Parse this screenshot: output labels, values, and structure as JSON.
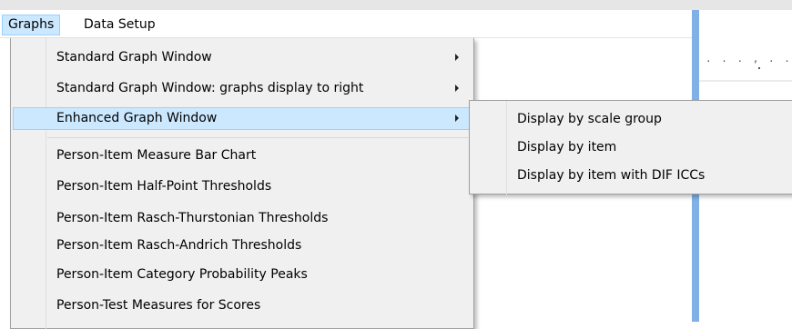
{
  "menubar": {
    "items": [
      {
        "label": "Graphs",
        "active": true
      },
      {
        "label": "Data Setup",
        "active": false
      }
    ]
  },
  "graphs_menu": {
    "items": [
      {
        "label": "Standard Graph Window",
        "has_submenu": true
      },
      {
        "label": "Standard Graph Window: graphs display to right",
        "has_submenu": true
      },
      {
        "label": "Enhanced Graph Window",
        "has_submenu": true,
        "highlighted": true
      },
      {
        "label": "Person-Item Measure Bar Chart",
        "has_submenu": false
      },
      {
        "label": "Person-Item Half-Point Thresholds",
        "has_submenu": false
      },
      {
        "label": "Person-Item Rasch-Thurstonian Thresholds",
        "has_submenu": false
      },
      {
        "label": "Person-Item Rasch-Andrich Thresholds",
        "has_submenu": false
      },
      {
        "label": "Person-Item Category Probability Peaks",
        "has_submenu": false
      },
      {
        "label": "Person-Test Measures for Scores",
        "has_submenu": false
      }
    ]
  },
  "enhanced_submenu": {
    "items": [
      {
        "label": "Display by scale group"
      },
      {
        "label": "Display by item"
      },
      {
        "label": "Display by item with DIF ICCs"
      }
    ]
  },
  "background": {
    "dots_row1": ". . . , . .",
    "dots_row2": "."
  },
  "colors": {
    "highlight_fill": "#cce8ff",
    "highlight_border": "#99d1ff",
    "menu_background": "#f0f0f0",
    "window_border": "#7fb1e6"
  }
}
